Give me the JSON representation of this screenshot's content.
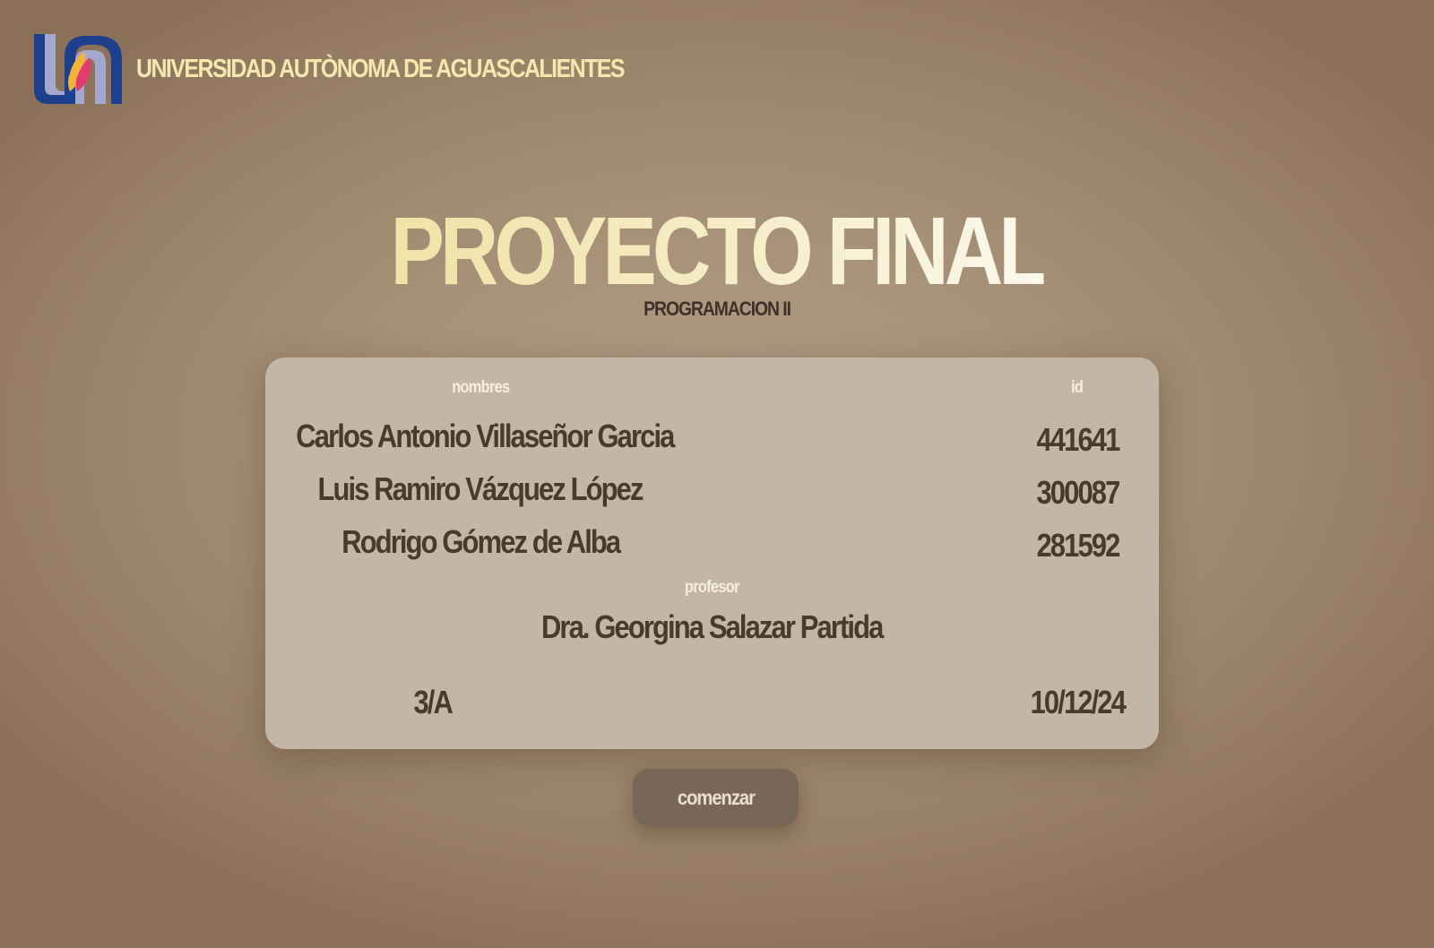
{
  "header": {
    "university_name": "UNIVERSIDAD AUTÒNOMA DE AGUASCALIENTES",
    "logo_icon": "uaa-logo-icon"
  },
  "main": {
    "title": "PROYECTO FINAL",
    "subtitle": "PROGRAMACION II"
  },
  "card": {
    "names_label": "nombres",
    "id_label": "id",
    "students": [
      {
        "name": "Carlos Antonio Villaseñor Garcia",
        "id": "441641"
      },
      {
        "name": "Luis Ramiro Vázquez López",
        "id": "300087"
      },
      {
        "name": "Rodrigo Gómez de Alba",
        "id": "281592"
      }
    ],
    "professor_label": "profesor",
    "professor_name": "Dra. Georgina Salazar Partida",
    "group": "3/A",
    "date": "10/12/24"
  },
  "actions": {
    "start_label": "comenzar"
  },
  "colors": {
    "title": "#f4ebc4",
    "university_name": "#f4e8b0",
    "card_background": "#c4b6a6",
    "card_text": "#4a3a2d",
    "button_background": "#786657",
    "logo_blue": "#1d3f8c",
    "logo_lavender": "#a3a8cf"
  }
}
